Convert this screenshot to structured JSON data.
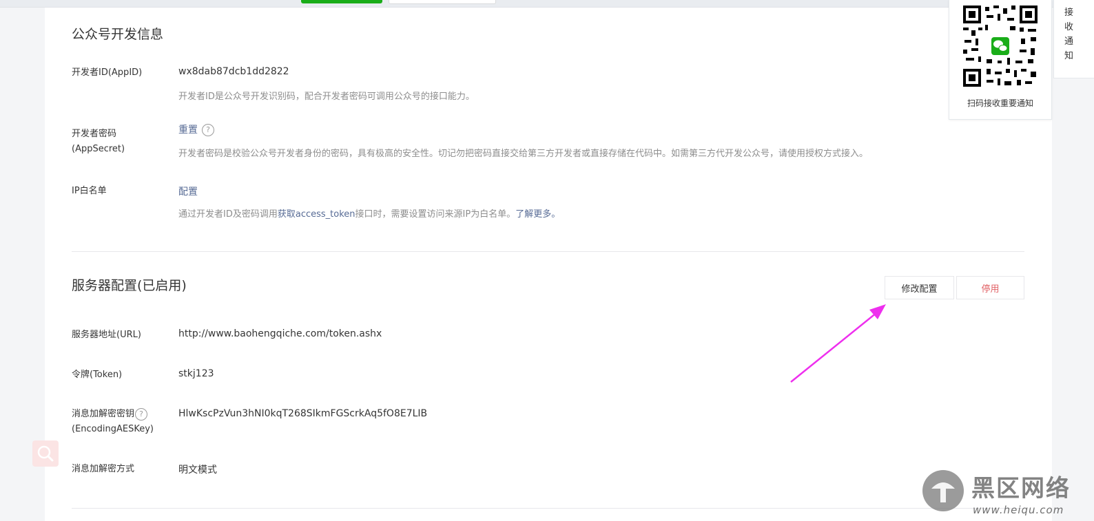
{
  "dev_info": {
    "title": "公众号开发信息",
    "appid_label": "开发者ID(AppID)",
    "appid_value": "wx8dab87dcb1dd2822",
    "appid_desc": "开发者ID是公众号开发识别码，配合开发者密码可调用公众号的接口能力。",
    "secret_label_line1": "开发者密码",
    "secret_label_line2": "(AppSecret)",
    "secret_action": "重置",
    "secret_desc": "开发者密码是校验公众号开发者身份的密码，具有极高的安全性。切记勿把密码直接交给第三方开发者或直接存储在代码中。如需第三方代开发公众号，请使用授权方式接入。",
    "ip_label": "IP白名单",
    "ip_action": "配置",
    "ip_desc_prefix": "通过开发者ID及密码调用",
    "ip_desc_link": "获取access_token",
    "ip_desc_middle": "接口时，需要设置访问来源IP为白名单。",
    "ip_desc_more": "了解更多。"
  },
  "server": {
    "title": "服务器配置(已启用)",
    "modify_button": "修改配置",
    "disable_button": "停用",
    "url_label": "服务器地址(URL)",
    "url_value": "http://www.baohengqiche.com/token.ashx",
    "token_label": "令牌(Token)",
    "token_value": "stkj123",
    "aeskey_label_line1": "消息加解密密钥",
    "aeskey_label_line2": "(EncodingAESKey)",
    "aeskey_value": "HlwKscPzVun3hNI0kqT268SIkmFGScrkAq5fO8E7LIB",
    "mode_label": "消息加解密方式",
    "mode_value": "明文模式"
  },
  "qr_panel": {
    "caption": "扫码接收重要通知"
  },
  "side_tab": {
    "label": "接收通知"
  },
  "watermark": {
    "brand": "黑区网络",
    "url": "www.heiqu.com"
  },
  "colors": {
    "link": "#576b95",
    "danger": "#e15f63",
    "arrow": "#ee2fee",
    "wechat_green": "#1aad19"
  }
}
